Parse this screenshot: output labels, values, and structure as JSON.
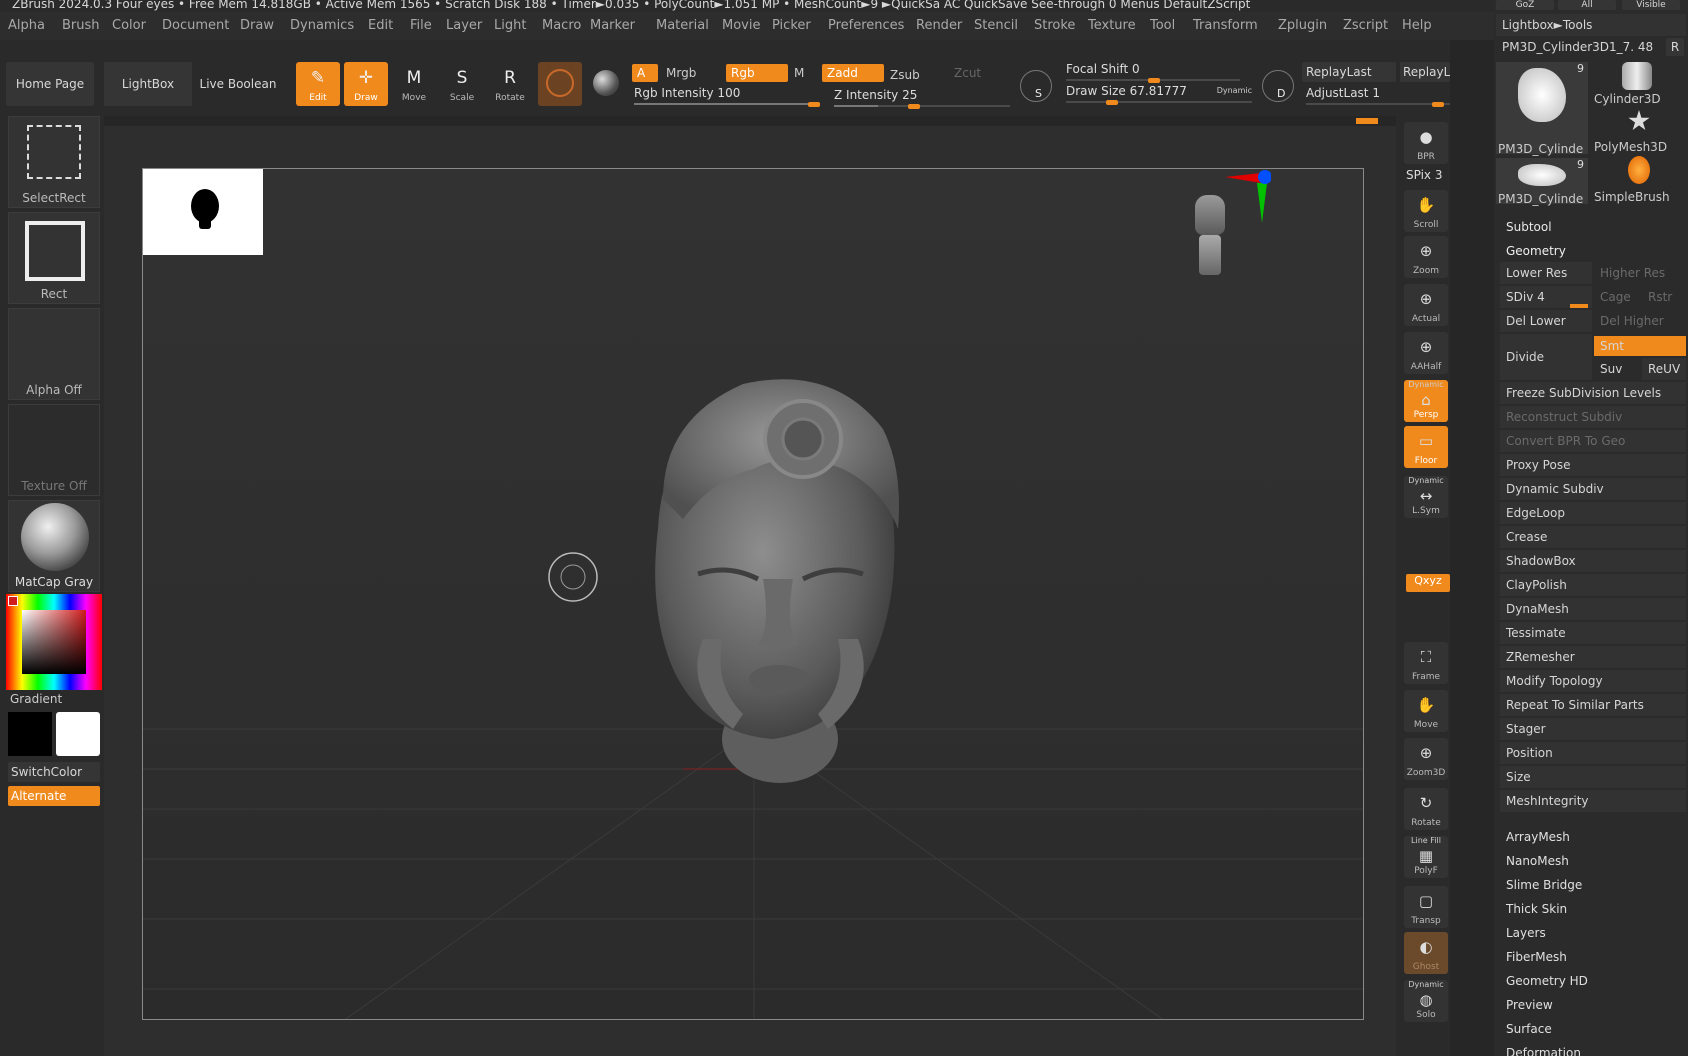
{
  "window": {
    "title": "ZBrush 2024.0.3 Four eyes   • Free Mem 14.818GB • Active Mem 1565 • Scratch Disk 188 •  Timer►0.035 • PolyCount►1.051 MP  • MeshCount►9  ►QuickSa   AC       QuickSave       See-through  0      Menus  DefaultZScript",
    "menus": [
      "Alpha",
      "Brush",
      "Color",
      "Document",
      "Draw",
      "Dynamics",
      "Edit",
      "File",
      "Layer",
      "Light",
      "Macro",
      "Marker",
      "Material",
      "Movie",
      "Picker",
      "Preferences",
      "Render",
      "Stencil",
      "Stroke",
      "Texture",
      "Tool",
      "Transform",
      "Zplugin",
      "Zscript",
      "Help"
    ]
  },
  "toolbar": {
    "home_page": "Home Page",
    "lightbox": "LightBox",
    "live_boolean": "Live Boolean",
    "tools": [
      {
        "label": "Edit",
        "icon": "edit-icon",
        "active": true
      },
      {
        "label": "Draw",
        "icon": "draw-icon",
        "active": true
      },
      {
        "label": "Move",
        "icon": "move-icon",
        "active": false
      },
      {
        "label": "Scale",
        "icon": "scale-icon",
        "active": false
      },
      {
        "label": "Rotate",
        "icon": "rotate-icon",
        "active": false
      }
    ],
    "a": "A",
    "mrgb": "Mrgb",
    "rgb": "Rgb",
    "m": "M",
    "zadd": "Zadd",
    "zsub": "Zsub",
    "zcut": "Zcut",
    "rgb_intensity": "Rgb Intensity 100",
    "z_intensity": "Z Intensity 25",
    "focal_shift": "Focal Shift 0",
    "draw_size": "Draw Size 67.81777",
    "dynamic": "Dynamic",
    "s_label": "S",
    "d_label": "D",
    "replay_last": "ReplayLast",
    "replay_la": "ReplayLa",
    "adjust_last": "AdjustLast 1"
  },
  "left_shelf": {
    "select_rect": "SelectRect",
    "rect": "Rect",
    "alpha_off": "Alpha Off",
    "texture_off": "Texture Off",
    "matcap": "MatCap Gray",
    "gradient": "Gradient",
    "switch_color": "SwitchColor",
    "alternate": "Alternate"
  },
  "right_shelf": {
    "buttons": [
      {
        "label": "BPR"
      },
      {
        "label": "Scroll"
      },
      {
        "label": "Zoom"
      },
      {
        "label": "Actual"
      },
      {
        "label": "AAHalf"
      },
      {
        "label": "Persp",
        "top": "Dynamic"
      },
      {
        "label": "Floor"
      },
      {
        "label": "L.Sym",
        "top": "Dynamic"
      },
      {
        "label": "Frame"
      },
      {
        "label": "Move"
      },
      {
        "label": "Zoom3D"
      },
      {
        "label": "Rotate"
      },
      {
        "label": "PolyF",
        "top": "Line Fill"
      },
      {
        "label": "Transp"
      },
      {
        "label": "Ghost"
      },
      {
        "label": "Solo",
        "top": "Dynamic"
      }
    ],
    "spix": "SPix 3",
    "xyz": "Qxyz"
  },
  "tray": {
    "top_buttons": [
      "GoZ",
      "All",
      "Visible"
    ],
    "lightbox_tools": "Lightbox►Tools",
    "current_tool": "PM3D_Cylinder3D1_7. 48",
    "r": "R",
    "thumbs": [
      {
        "label": "PM3D_Cylinde",
        "count": "9"
      },
      {
        "label": "Cylinder3D"
      },
      {
        "label": "PolyMesh3D"
      },
      {
        "label": "PM3D_Cylinde",
        "count": "9"
      },
      {
        "label": "SimpleBrush"
      }
    ],
    "subtool": "Subtool",
    "geometry": "Geometry",
    "lower_res": "Lower Res",
    "higher_res": "Higher Res",
    "sdiv": "SDiv 4",
    "cage": "Cage",
    "rstr": "Rstr",
    "del_lower": "Del Lower",
    "del_higher": "Del Higher",
    "divide": "Divide",
    "smt": "Smt",
    "suv": "Suv",
    "reuv": "ReUV",
    "geometry_items": [
      {
        "label": "Freeze SubDivision Levels",
        "enabled": true
      },
      {
        "label": "Reconstruct Subdiv",
        "enabled": false
      },
      {
        "label": "Convert BPR To Geo",
        "enabled": false
      },
      {
        "label": "Proxy Pose",
        "enabled": true
      },
      {
        "label": "Dynamic Subdiv",
        "enabled": true
      },
      {
        "label": "EdgeLoop",
        "enabled": true
      },
      {
        "label": "Crease",
        "enabled": true
      },
      {
        "label": "ShadowBox",
        "enabled": true
      },
      {
        "label": "ClayPolish",
        "enabled": true
      },
      {
        "label": "DynaMesh",
        "enabled": true
      },
      {
        "label": "Tessimate",
        "enabled": true
      },
      {
        "label": "ZRemesher",
        "enabled": true
      },
      {
        "label": "Modify Topology",
        "enabled": true
      },
      {
        "label": "Repeat To Similar Parts",
        "enabled": true
      },
      {
        "label": "Stager",
        "enabled": true
      },
      {
        "label": "Position",
        "enabled": true
      },
      {
        "label": "Size",
        "enabled": true
      },
      {
        "label": "MeshIntegrity",
        "enabled": true
      }
    ],
    "sections": [
      "ArrayMesh",
      "NanoMesh",
      "Slime Bridge",
      "Thick Skin",
      "Layers",
      "FiberMesh",
      "Geometry HD",
      "Preview",
      "Surface",
      "Deformation"
    ]
  },
  "colors": {
    "accent": "#f08a1c",
    "bg": "#262626"
  }
}
